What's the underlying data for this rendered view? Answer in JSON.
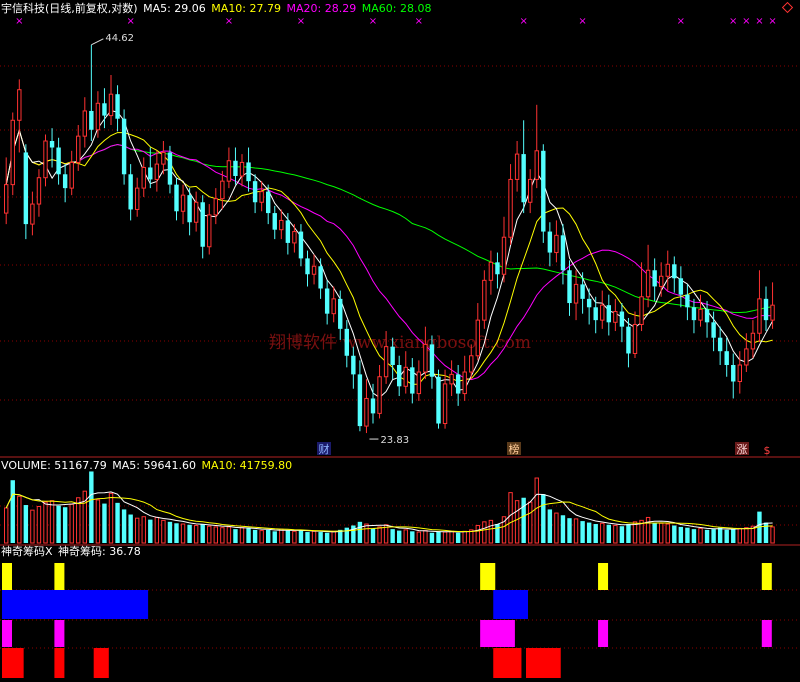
{
  "header": {
    "title": "宇信科技(日线,前复权,对数)",
    "ma5_label": "MA5: 29.06",
    "ma10_label": "MA10: 27.79",
    "ma20_label": "MA20: 28.29",
    "ma60_label": "MA60: 28.08"
  },
  "volume_header": {
    "volume_label": "VOLUME: 51167.79",
    "ma5_label": "MA5: 59641.60",
    "ma10_label": "MA10: 41759.80"
  },
  "indicator_header": {
    "name_label": "神奇筹码X",
    "value_label": "神奇筹码: 36.78"
  },
  "annotations": {
    "high_label": "44.62",
    "low_label": "23.83",
    "event_cai": "财",
    "event_bang": "榜",
    "event_zhang": "涨",
    "event_dollar": "$",
    "watermark": "翔博软件 www.xiangbosoft.com"
  },
  "colors": {
    "background": "#000000",
    "up": "#ff3232",
    "down": "#54ffff",
    "ma5": "#ffffff",
    "ma10": "#ffff00",
    "ma20": "#ff00ff",
    "ma60": "#00ff00",
    "grid": "#8b0000",
    "block_yellow": "#ffff00",
    "block_blue": "#0000ff",
    "block_magenta": "#ff00ff",
    "block_red": "#ff0000"
  },
  "chart_data": {
    "type": "candlestick",
    "scale": "log",
    "ylim": [
      23.0,
      46.0
    ],
    "price_high": 44.62,
    "price_low": 23.83,
    "candles": [
      [
        34.0,
        35.6,
        37.2,
        33.4
      ],
      [
        35.6,
        39.5,
        40.0,
        35.0
      ],
      [
        39.5,
        41.5,
        42.2,
        37.5
      ],
      [
        37.5,
        33.4,
        38.0,
        32.6
      ],
      [
        33.4,
        34.5,
        35.2,
        32.8
      ],
      [
        34.5,
        36.0,
        36.5,
        33.8
      ],
      [
        36.0,
        38.2,
        38.6,
        35.5
      ],
      [
        38.2,
        37.8,
        39.0,
        36.6
      ],
      [
        37.8,
        36.2,
        38.4,
        35.6
      ],
      [
        36.2,
        35.4,
        36.8,
        34.6
      ],
      [
        35.4,
        36.9,
        37.6,
        35.0
      ],
      [
        36.9,
        38.5,
        39.2,
        36.4
      ],
      [
        38.5,
        40.1,
        41.0,
        37.8
      ],
      [
        40.1,
        38.9,
        44.62,
        38.2
      ],
      [
        38.9,
        40.6,
        41.4,
        38.4
      ],
      [
        40.6,
        39.8,
        41.6,
        39.0
      ],
      [
        39.8,
        41.2,
        42.5,
        39.2
      ],
      [
        41.2,
        39.6,
        41.8,
        38.8
      ],
      [
        39.6,
        36.2,
        40.2,
        35.6
      ],
      [
        36.2,
        34.2,
        36.8,
        33.6
      ],
      [
        34.2,
        35.4,
        36.0,
        33.8
      ],
      [
        35.4,
        36.6,
        37.2,
        34.9
      ],
      [
        36.6,
        35.9,
        37.8,
        35.4
      ],
      [
        35.9,
        36.8,
        37.6,
        35.2
      ],
      [
        36.8,
        37.5,
        38.2,
        36.2
      ],
      [
        37.5,
        35.6,
        37.9,
        35.1
      ],
      [
        35.6,
        34.1,
        36.0,
        33.6
      ],
      [
        34.1,
        35.0,
        35.6,
        33.4
      ],
      [
        35.0,
        33.5,
        35.4,
        32.8
      ],
      [
        33.5,
        34.6,
        35.2,
        33.0
      ],
      [
        34.6,
        32.2,
        35.0,
        31.6
      ],
      [
        32.2,
        33.9,
        34.5,
        31.8
      ],
      [
        33.9,
        34.8,
        35.4,
        33.4
      ],
      [
        34.8,
        35.8,
        36.4,
        34.2
      ],
      [
        35.8,
        37.0,
        37.8,
        35.4
      ],
      [
        37.0,
        36.1,
        37.8,
        35.6
      ],
      [
        36.1,
        36.9,
        37.4,
        35.5
      ],
      [
        36.9,
        35.8,
        37.8,
        35.2
      ],
      [
        35.8,
        34.6,
        36.2,
        34.0
      ],
      [
        34.6,
        35.2,
        35.8,
        34.1
      ],
      [
        35.2,
        34.0,
        35.6,
        33.4
      ],
      [
        34.0,
        33.1,
        34.4,
        32.6
      ],
      [
        33.1,
        33.6,
        34.2,
        32.6
      ],
      [
        33.6,
        32.4,
        34.0,
        31.8
      ],
      [
        32.4,
        33.0,
        33.4,
        31.9
      ],
      [
        33.0,
        31.6,
        33.4,
        31.2
      ],
      [
        31.6,
        30.8,
        32.0,
        30.2
      ],
      [
        30.8,
        31.2,
        31.8,
        30.3
      ],
      [
        31.2,
        30.1,
        31.6,
        29.6
      ],
      [
        30.1,
        28.9,
        30.5,
        28.4
      ],
      [
        28.9,
        29.6,
        30.2,
        28.5
      ],
      [
        29.6,
        28.2,
        30.0,
        27.7
      ],
      [
        28.2,
        27.0,
        28.6,
        26.5
      ],
      [
        27.0,
        26.2,
        27.4,
        25.6
      ],
      [
        26.2,
        24.1,
        26.8,
        23.9
      ],
      [
        24.1,
        25.2,
        26.0,
        23.83
      ],
      [
        25.2,
        24.6,
        25.8,
        24.2
      ],
      [
        24.6,
        26.1,
        26.6,
        24.4
      ],
      [
        26.1,
        27.4,
        28.1,
        25.8
      ],
      [
        27.4,
        26.6,
        27.8,
        26.0
      ],
      [
        26.6,
        25.7,
        27.0,
        25.3
      ],
      [
        25.7,
        26.5,
        27.2,
        25.4
      ],
      [
        26.5,
        25.4,
        26.9,
        25.0
      ],
      [
        25.4,
        26.3,
        26.8,
        25.1
      ],
      [
        26.3,
        27.5,
        28.3,
        26.0
      ],
      [
        27.5,
        26.1,
        27.9,
        25.6
      ],
      [
        26.1,
        24.2,
        26.4,
        24.0
      ],
      [
        24.2,
        25.8,
        26.4,
        24.0
      ],
      [
        25.8,
        26.2,
        26.8,
        25.3
      ],
      [
        26.2,
        25.4,
        26.6,
        24.9
      ],
      [
        25.4,
        26.3,
        27.0,
        25.1
      ],
      [
        26.3,
        27.0,
        27.5,
        26.0
      ],
      [
        27.0,
        28.6,
        29.4,
        26.8
      ],
      [
        28.6,
        30.5,
        31.0,
        28.2
      ],
      [
        30.5,
        31.4,
        32.0,
        29.8
      ],
      [
        31.4,
        30.8,
        31.9,
        30.1
      ],
      [
        30.8,
        32.7,
        33.8,
        30.4
      ],
      [
        32.7,
        35.9,
        36.8,
        32.3
      ],
      [
        35.9,
        37.4,
        38.2,
        35.2
      ],
      [
        37.4,
        34.6,
        39.5,
        34.0
      ],
      [
        34.6,
        35.9,
        36.5,
        34.0
      ],
      [
        35.9,
        37.6,
        40.5,
        35.4
      ],
      [
        37.6,
        33.0,
        38.0,
        32.4
      ],
      [
        33.0,
        31.9,
        33.5,
        31.2
      ],
      [
        31.9,
        32.8,
        33.6,
        31.4
      ],
      [
        32.8,
        31.0,
        33.4,
        30.3
      ],
      [
        31.0,
        29.4,
        31.5,
        28.8
      ],
      [
        29.4,
        30.3,
        31.0,
        28.6
      ],
      [
        30.3,
        29.6,
        30.9,
        28.9
      ],
      [
        29.6,
        29.2,
        30.1,
        28.4
      ],
      [
        29.2,
        28.6,
        29.7,
        28.0
      ],
      [
        28.6,
        29.3,
        30.0,
        28.2
      ],
      [
        29.3,
        28.5,
        29.8,
        27.9
      ],
      [
        28.5,
        29.0,
        29.6,
        28.1
      ],
      [
        29.0,
        28.3,
        29.4,
        27.6
      ],
      [
        28.3,
        27.1,
        28.7,
        26.5
      ],
      [
        27.1,
        28.4,
        29.0,
        26.9
      ],
      [
        28.4,
        29.7,
        31.4,
        28.1
      ],
      [
        29.7,
        31.0,
        32.3,
        29.2
      ],
      [
        31.0,
        30.2,
        31.6,
        29.5
      ],
      [
        30.2,
        30.7,
        31.4,
        29.7
      ],
      [
        30.7,
        31.3,
        32.0,
        30.0
      ],
      [
        31.3,
        30.6,
        31.7,
        29.9
      ],
      [
        30.6,
        29.8,
        31.2,
        29.2
      ],
      [
        29.8,
        29.2,
        30.3,
        28.6
      ],
      [
        29.2,
        28.6,
        29.6,
        28.0
      ],
      [
        28.6,
        29.1,
        29.8,
        28.3
      ],
      [
        29.1,
        28.5,
        29.5,
        27.8
      ],
      [
        28.5,
        27.8,
        29.0,
        27.2
      ],
      [
        27.8,
        27.2,
        28.3,
        26.6
      ],
      [
        27.2,
        26.6,
        27.8,
        26.1
      ],
      [
        26.6,
        25.9,
        27.1,
        25.2
      ],
      [
        25.9,
        26.6,
        27.2,
        25.4
      ],
      [
        26.6,
        27.3,
        28.0,
        26.3
      ],
      [
        27.3,
        28.0,
        28.6,
        26.9
      ],
      [
        28.0,
        29.6,
        31.0,
        27.6
      ],
      [
        29.6,
        28.6,
        30.2,
        28.1
      ],
      [
        28.6,
        29.3,
        30.4,
        28.2
      ]
    ],
    "volume": [
      [
        4.8,
        1
      ],
      [
        8.6,
        0
      ],
      [
        6.4,
        1
      ],
      [
        5.2,
        0
      ],
      [
        4.5,
        1
      ],
      [
        5.0,
        1
      ],
      [
        5.6,
        1
      ],
      [
        5.8,
        1
      ],
      [
        5.1,
        0
      ],
      [
        4.9,
        0
      ],
      [
        5.3,
        1
      ],
      [
        6.2,
        1
      ],
      [
        7.1,
        1
      ],
      [
        9.8,
        0
      ],
      [
        5.9,
        1
      ],
      [
        5.4,
        0
      ],
      [
        6.8,
        1
      ],
      [
        5.5,
        0
      ],
      [
        4.6,
        0
      ],
      [
        3.9,
        0
      ],
      [
        3.4,
        1
      ],
      [
        3.6,
        1
      ],
      [
        3.2,
        0
      ],
      [
        3.5,
        1
      ],
      [
        3.1,
        1
      ],
      [
        2.9,
        0
      ],
      [
        2.7,
        0
      ],
      [
        2.6,
        1
      ],
      [
        2.5,
        0
      ],
      [
        2.4,
        1
      ],
      [
        2.6,
        0
      ],
      [
        2.3,
        1
      ],
      [
        2.2,
        1
      ],
      [
        2.1,
        1
      ],
      [
        2.2,
        1
      ],
      [
        1.9,
        0
      ],
      [
        2.1,
        1
      ],
      [
        2.0,
        0
      ],
      [
        1.8,
        0
      ],
      [
        1.7,
        1
      ],
      [
        1.8,
        0
      ],
      [
        1.6,
        0
      ],
      [
        1.9,
        1
      ],
      [
        1.7,
        0
      ],
      [
        1.6,
        1
      ],
      [
        1.8,
        0
      ],
      [
        1.5,
        0
      ],
      [
        1.6,
        1
      ],
      [
        1.5,
        0
      ],
      [
        1.4,
        0
      ],
      [
        1.6,
        1
      ],
      [
        1.8,
        0
      ],
      [
        2.1,
        0
      ],
      [
        2.4,
        0
      ],
      [
        2.9,
        0
      ],
      [
        2.6,
        1
      ],
      [
        2.0,
        0
      ],
      [
        2.2,
        1
      ],
      [
        2.5,
        1
      ],
      [
        1.9,
        0
      ],
      [
        1.7,
        0
      ],
      [
        1.8,
        1
      ],
      [
        1.6,
        0
      ],
      [
        1.5,
        1
      ],
      [
        1.7,
        1
      ],
      [
        1.4,
        0
      ],
      [
        1.6,
        0
      ],
      [
        1.5,
        1
      ],
      [
        1.6,
        1
      ],
      [
        1.4,
        0
      ],
      [
        1.6,
        1
      ],
      [
        1.8,
        1
      ],
      [
        2.4,
        1
      ],
      [
        2.9,
        1
      ],
      [
        3.1,
        1
      ],
      [
        2.6,
        0
      ],
      [
        3.6,
        1
      ],
      [
        6.9,
        1
      ],
      [
        5.8,
        1
      ],
      [
        6.2,
        0
      ],
      [
        5.6,
        1
      ],
      [
        8.9,
        1
      ],
      [
        6.7,
        0
      ],
      [
        4.6,
        0
      ],
      [
        4.1,
        1
      ],
      [
        3.8,
        0
      ],
      [
        3.4,
        0
      ],
      [
        3.3,
        1
      ],
      [
        3.0,
        0
      ],
      [
        2.8,
        0
      ],
      [
        2.6,
        0
      ],
      [
        2.7,
        1
      ],
      [
        2.5,
        0
      ],
      [
        2.4,
        1
      ],
      [
        2.3,
        0
      ],
      [
        2.6,
        0
      ],
      [
        2.9,
        1
      ],
      [
        3.1,
        1
      ],
      [
        3.5,
        1
      ],
      [
        2.8,
        0
      ],
      [
        2.7,
        1
      ],
      [
        2.6,
        1
      ],
      [
        2.4,
        0
      ],
      [
        2.2,
        0
      ],
      [
        2.1,
        0
      ],
      [
        1.9,
        0
      ],
      [
        2.0,
        1
      ],
      [
        1.8,
        0
      ],
      [
        1.9,
        0
      ],
      [
        2.1,
        0
      ],
      [
        1.8,
        0
      ],
      [
        1.9,
        0
      ],
      [
        2.0,
        1
      ],
      [
        2.1,
        1
      ],
      [
        2.3,
        1
      ],
      [
        4.3,
        0
      ],
      [
        2.8,
        0
      ],
      [
        2.2,
        1
      ]
    ],
    "volume_max": 10.0,
    "indicator_blocks": {
      "rows": [
        "yellow",
        "blue",
        "magenta",
        "red"
      ],
      "yellow": [
        [
          0,
          1
        ],
        [
          8,
          9
        ],
        [
          73,
          75
        ],
        [
          91,
          92
        ],
        [
          116,
          117
        ]
      ],
      "blue": [
        [
          0,
          22
        ],
        [
          75,
          80
        ]
      ],
      "magenta": [
        [
          0,
          1
        ],
        [
          8,
          9
        ],
        [
          73,
          78
        ],
        [
          91,
          92
        ],
        [
          116,
          117
        ]
      ],
      "red": [
        [
          0,
          3
        ],
        [
          8,
          9
        ],
        [
          14,
          16
        ],
        [
          75,
          79
        ],
        [
          80,
          85
        ]
      ]
    }
  }
}
